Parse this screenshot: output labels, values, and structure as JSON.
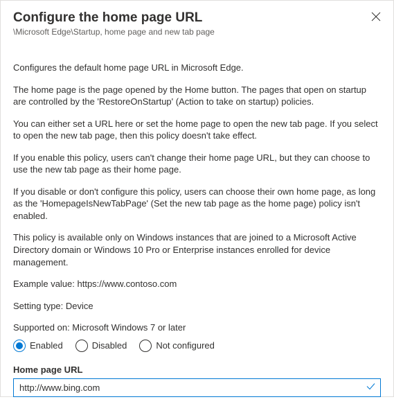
{
  "header": {
    "title": "Configure the home page URL",
    "breadcrumb": "\\Microsoft Edge\\Startup, home page and new tab page"
  },
  "body": {
    "p1": "Configures the default home page URL in Microsoft Edge.",
    "p2": "The home page is the page opened by the Home button. The pages that open on startup are controlled by the 'RestoreOnStartup' (Action to take on startup) policies.",
    "p3": "You can either set a URL here or set the home page to open the new tab page. If you select to open the new tab page, then this policy doesn't take effect.",
    "p4": "If you enable this policy, users can't change their home page URL, but they can choose to use the new tab page as their home page.",
    "p5": "If you disable or don't configure this policy, users can choose their own home page, as long as the 'HomepageIsNewTabPage' (Set the new tab page as the home page) policy isn't enabled.",
    "p6": "This policy is available only on Windows instances that are joined to a Microsoft Active Directory domain or Windows 10 Pro or Enterprise instances enrolled for device management.",
    "example": "Example value: https://www.contoso.com",
    "setting_type": "Setting type: Device",
    "supported_on": "Supported on: Microsoft Windows 7 or later"
  },
  "radios": {
    "enabled": "Enabled",
    "disabled": "Disabled",
    "not_configured": "Not configured",
    "selected": "enabled"
  },
  "url_field": {
    "label": "Home page URL",
    "value": "http://www.bing.com"
  }
}
